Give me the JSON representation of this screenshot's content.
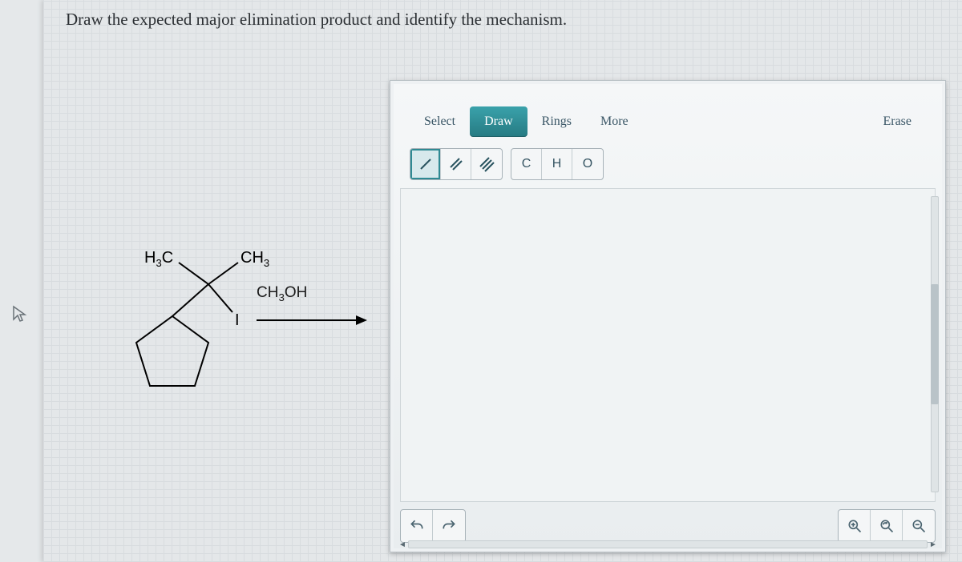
{
  "question": "Draw the expected major elimination product and identify the mechanism.",
  "molecule": {
    "atom_labels": {
      "left": "H3C",
      "right": "CH3",
      "leaving_group": "I"
    },
    "reagent": "CH3OH"
  },
  "editor": {
    "toolbar": {
      "select": "Select",
      "draw": "Draw",
      "rings": "Rings",
      "more": "More",
      "erase": "Erase",
      "active": "draw"
    },
    "bond_buttons": [
      "/",
      "//",
      "///"
    ],
    "selected_bond_index": 0,
    "atom_buttons": [
      "C",
      "H",
      "O"
    ],
    "history_icons": [
      "undo",
      "redo"
    ],
    "zoom_icons": [
      "zoom-in",
      "zoom-reset",
      "zoom-out"
    ]
  }
}
